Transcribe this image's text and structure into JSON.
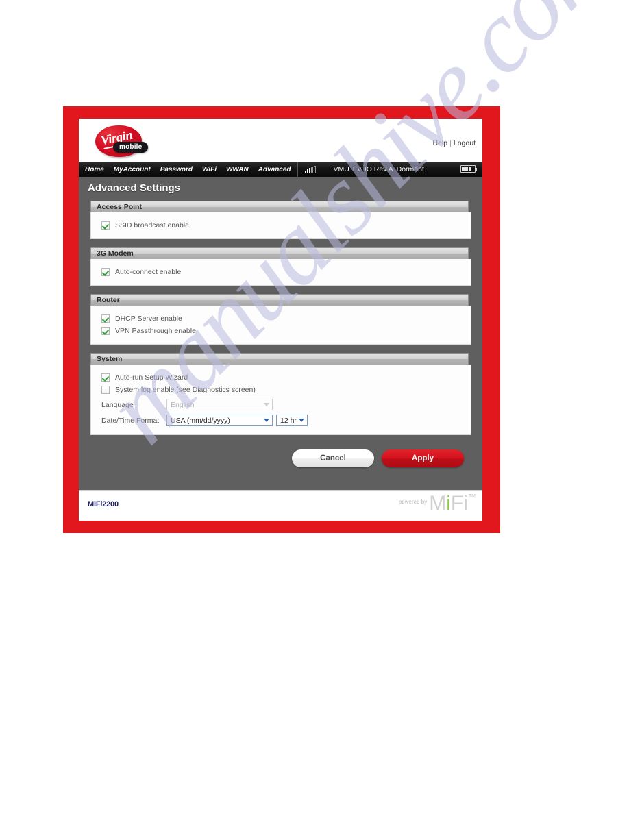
{
  "watermark": {
    "text": "manualshive.com"
  },
  "brand": {
    "logo_script": "Virgin",
    "logo_pill": "mobile",
    "accent_red": "#e2171e",
    "accent_green": "#8cc63f"
  },
  "header": {
    "help_label": "Help",
    "separator": "|",
    "logout_label": "Logout"
  },
  "nav": {
    "tabs": [
      {
        "label": "Home"
      },
      {
        "label": "MyAccount"
      },
      {
        "label": "Password"
      },
      {
        "label": "WiFi"
      },
      {
        "label": "WWAN"
      },
      {
        "label": "Advanced"
      }
    ],
    "status": {
      "carrier": "VMU",
      "technology": "EvDO Rev.A",
      "state": "Dormant",
      "signal_bars_filled": 3,
      "signal_bars_total": 5,
      "battery_segments_filled": 3,
      "battery_segments_total": 4
    }
  },
  "page": {
    "title": "Advanced Settings"
  },
  "sections": {
    "access_point": {
      "title": "Access Point",
      "ssid_broadcast": {
        "label": "SSID broadcast enable",
        "checked": true
      }
    },
    "modem_3g": {
      "title": "3G Modem",
      "auto_connect": {
        "label": "Auto-connect enable",
        "checked": true
      }
    },
    "router": {
      "title": "Router",
      "dhcp_server": {
        "label": "DHCP Server enable",
        "checked": true
      },
      "vpn_passthrough": {
        "label": "VPN Passthrough enable",
        "checked": true
      }
    },
    "system": {
      "title": "System",
      "auto_run_wizard": {
        "label": "Auto-run Setup Wizard",
        "checked": true
      },
      "system_log": {
        "label": "System log enable (see Diagnostics screen)",
        "checked": false
      },
      "language": {
        "label": "Language",
        "value": "English",
        "disabled": true
      },
      "datetime": {
        "label": "Date/Time Format",
        "date_value": "USA (mm/dd/yyyy)",
        "time_value": "12 hr"
      }
    }
  },
  "buttons": {
    "cancel": "Cancel",
    "apply": "Apply"
  },
  "footer": {
    "model": "MiFi2200",
    "powered_by": "powered by",
    "brand_m": "M",
    "brand_i1": "i",
    "brand_f": "F",
    "brand_i2": "i",
    "trademark": "TM"
  }
}
